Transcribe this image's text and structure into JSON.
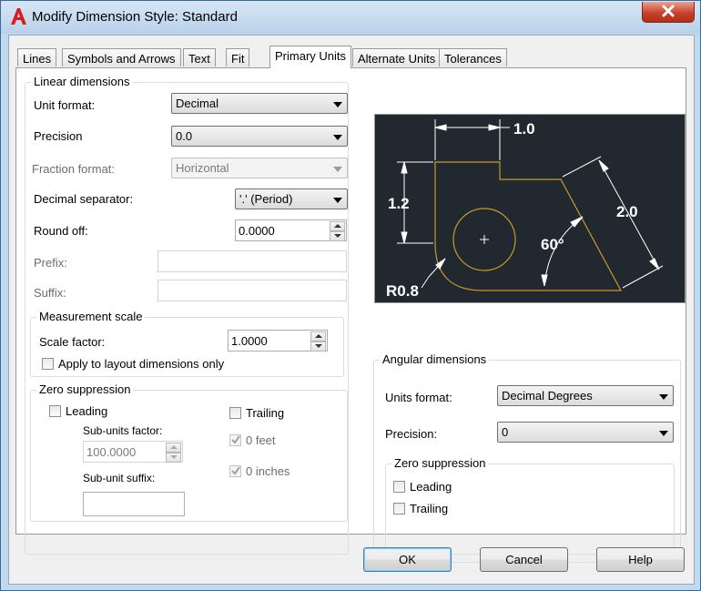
{
  "window": {
    "title": "Modify Dimension Style: Standard"
  },
  "tabs": [
    {
      "label": "Lines",
      "active": false
    },
    {
      "label": "Symbols and Arrows",
      "active": false
    },
    {
      "label": "Text",
      "active": false
    },
    {
      "label": "Fit",
      "active": false
    },
    {
      "label": "Primary Units",
      "active": true
    },
    {
      "label": "Alternate Units",
      "active": false
    },
    {
      "label": "Tolerances",
      "active": false
    }
  ],
  "linear": {
    "group_label": "Linear dimensions",
    "unit_format_label": "Unit format:",
    "unit_format_value": "Decimal",
    "precision_label": "Precision",
    "precision_value": "0.0",
    "fraction_format_label": "Fraction format:",
    "fraction_format_value": "Horizontal",
    "decimal_separator_label": "Decimal separator:",
    "decimal_separator_value": "'.' (Period)",
    "round_off_label": "Round off:",
    "round_off_value": "0.0000",
    "prefix_label": "Prefix:",
    "prefix_value": "",
    "suffix_label": "Suffix:",
    "suffix_value": ""
  },
  "measurement": {
    "group_label": "Measurement scale",
    "scale_factor_label": "Scale factor:",
    "scale_factor_value": "1.0000",
    "apply_layout_label": "Apply to layout dimensions only"
  },
  "zero_suppression": {
    "group_label": "Zero suppression",
    "leading_label": "Leading",
    "trailing_label": "Trailing",
    "sub_units_factor_label": "Sub-units factor:",
    "sub_units_factor_value": "100.0000",
    "sub_unit_suffix_label": "Sub-unit suffix:",
    "sub_unit_suffix_value": "",
    "feet_label": "0 feet",
    "inches_label": "0 inches"
  },
  "preview": {
    "dim_top": "1.0",
    "dim_left": "1.2",
    "dim_right": "2.0",
    "dim_angle": "60°",
    "dim_radius": "R0.8",
    "colors": {
      "background": "#212830",
      "geometry": "#c89a2a",
      "dimension": "#ffffff"
    }
  },
  "angular": {
    "group_label": "Angular dimensions",
    "units_format_label": "Units format:",
    "units_format_value": "Decimal Degrees",
    "precision_label": "Precision:",
    "precision_value": "0",
    "zero_group_label": "Zero suppression",
    "leading_label": "Leading",
    "trailing_label": "Trailing"
  },
  "buttons": {
    "ok": "OK",
    "cancel": "Cancel",
    "help": "Help"
  }
}
